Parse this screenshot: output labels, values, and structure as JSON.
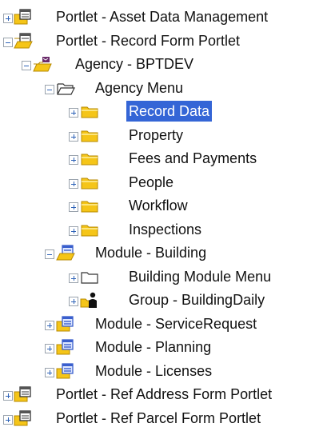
{
  "tree": {
    "items": [
      {
        "label": "Portlet - Asset Data Management",
        "icon": "portlet-icon",
        "expanded": false,
        "depth": 0,
        "selected": false
      },
      {
        "label": "Portlet - Record Form Portlet",
        "icon": "portlet-open-icon",
        "expanded": true,
        "depth": 0,
        "selected": false
      },
      {
        "label": "Agency - BPTDEV",
        "icon": "agency-icon",
        "expanded": true,
        "depth": 1,
        "selected": false
      },
      {
        "label": "Agency Menu",
        "icon": "open-folder-outline-icon",
        "expanded": true,
        "depth": 2,
        "selected": false
      },
      {
        "label": "Record Data",
        "icon": "folder-icon",
        "expanded": false,
        "depth": 3,
        "selected": true
      },
      {
        "label": "Property",
        "icon": "folder-icon",
        "expanded": false,
        "depth": 3,
        "selected": false
      },
      {
        "label": "Fees and Payments",
        "icon": "folder-icon",
        "expanded": false,
        "depth": 3,
        "selected": false
      },
      {
        "label": "People",
        "icon": "folder-icon",
        "expanded": false,
        "depth": 3,
        "selected": false
      },
      {
        "label": "Workflow",
        "icon": "folder-icon",
        "expanded": false,
        "depth": 3,
        "selected": false
      },
      {
        "label": "Inspections",
        "icon": "folder-icon",
        "expanded": false,
        "depth": 3,
        "selected": false
      },
      {
        "label": "Module - Building",
        "icon": "module-open-icon",
        "expanded": true,
        "depth": 2,
        "selected": false
      },
      {
        "label": "Building Module Menu",
        "icon": "folder-outline-icon",
        "expanded": false,
        "depth": 3,
        "selected": false
      },
      {
        "label": "Group - BuildingDaily",
        "icon": "group-icon",
        "expanded": false,
        "depth": 3,
        "selected": false
      },
      {
        "label": "Module - ServiceRequest",
        "icon": "module-icon",
        "expanded": false,
        "depth": 2,
        "selected": false
      },
      {
        "label": "Module - Planning",
        "icon": "module-icon",
        "expanded": false,
        "depth": 2,
        "selected": false
      },
      {
        "label": "Module - Licenses",
        "icon": "module-icon",
        "expanded": false,
        "depth": 2,
        "selected": false
      },
      {
        "label": "Portlet - Ref Address Form Portlet",
        "icon": "portlet-icon",
        "expanded": false,
        "depth": 0,
        "selected": false
      },
      {
        "label": "Portlet - Ref Parcel Form Portlet",
        "icon": "portlet-icon",
        "expanded": false,
        "depth": 0,
        "selected": false
      }
    ]
  },
  "colors": {
    "selection": "#3465d6",
    "folder": "#f5c518",
    "toggle_sign": "#2e63b8",
    "module_blue": "#3a5fcd"
  }
}
